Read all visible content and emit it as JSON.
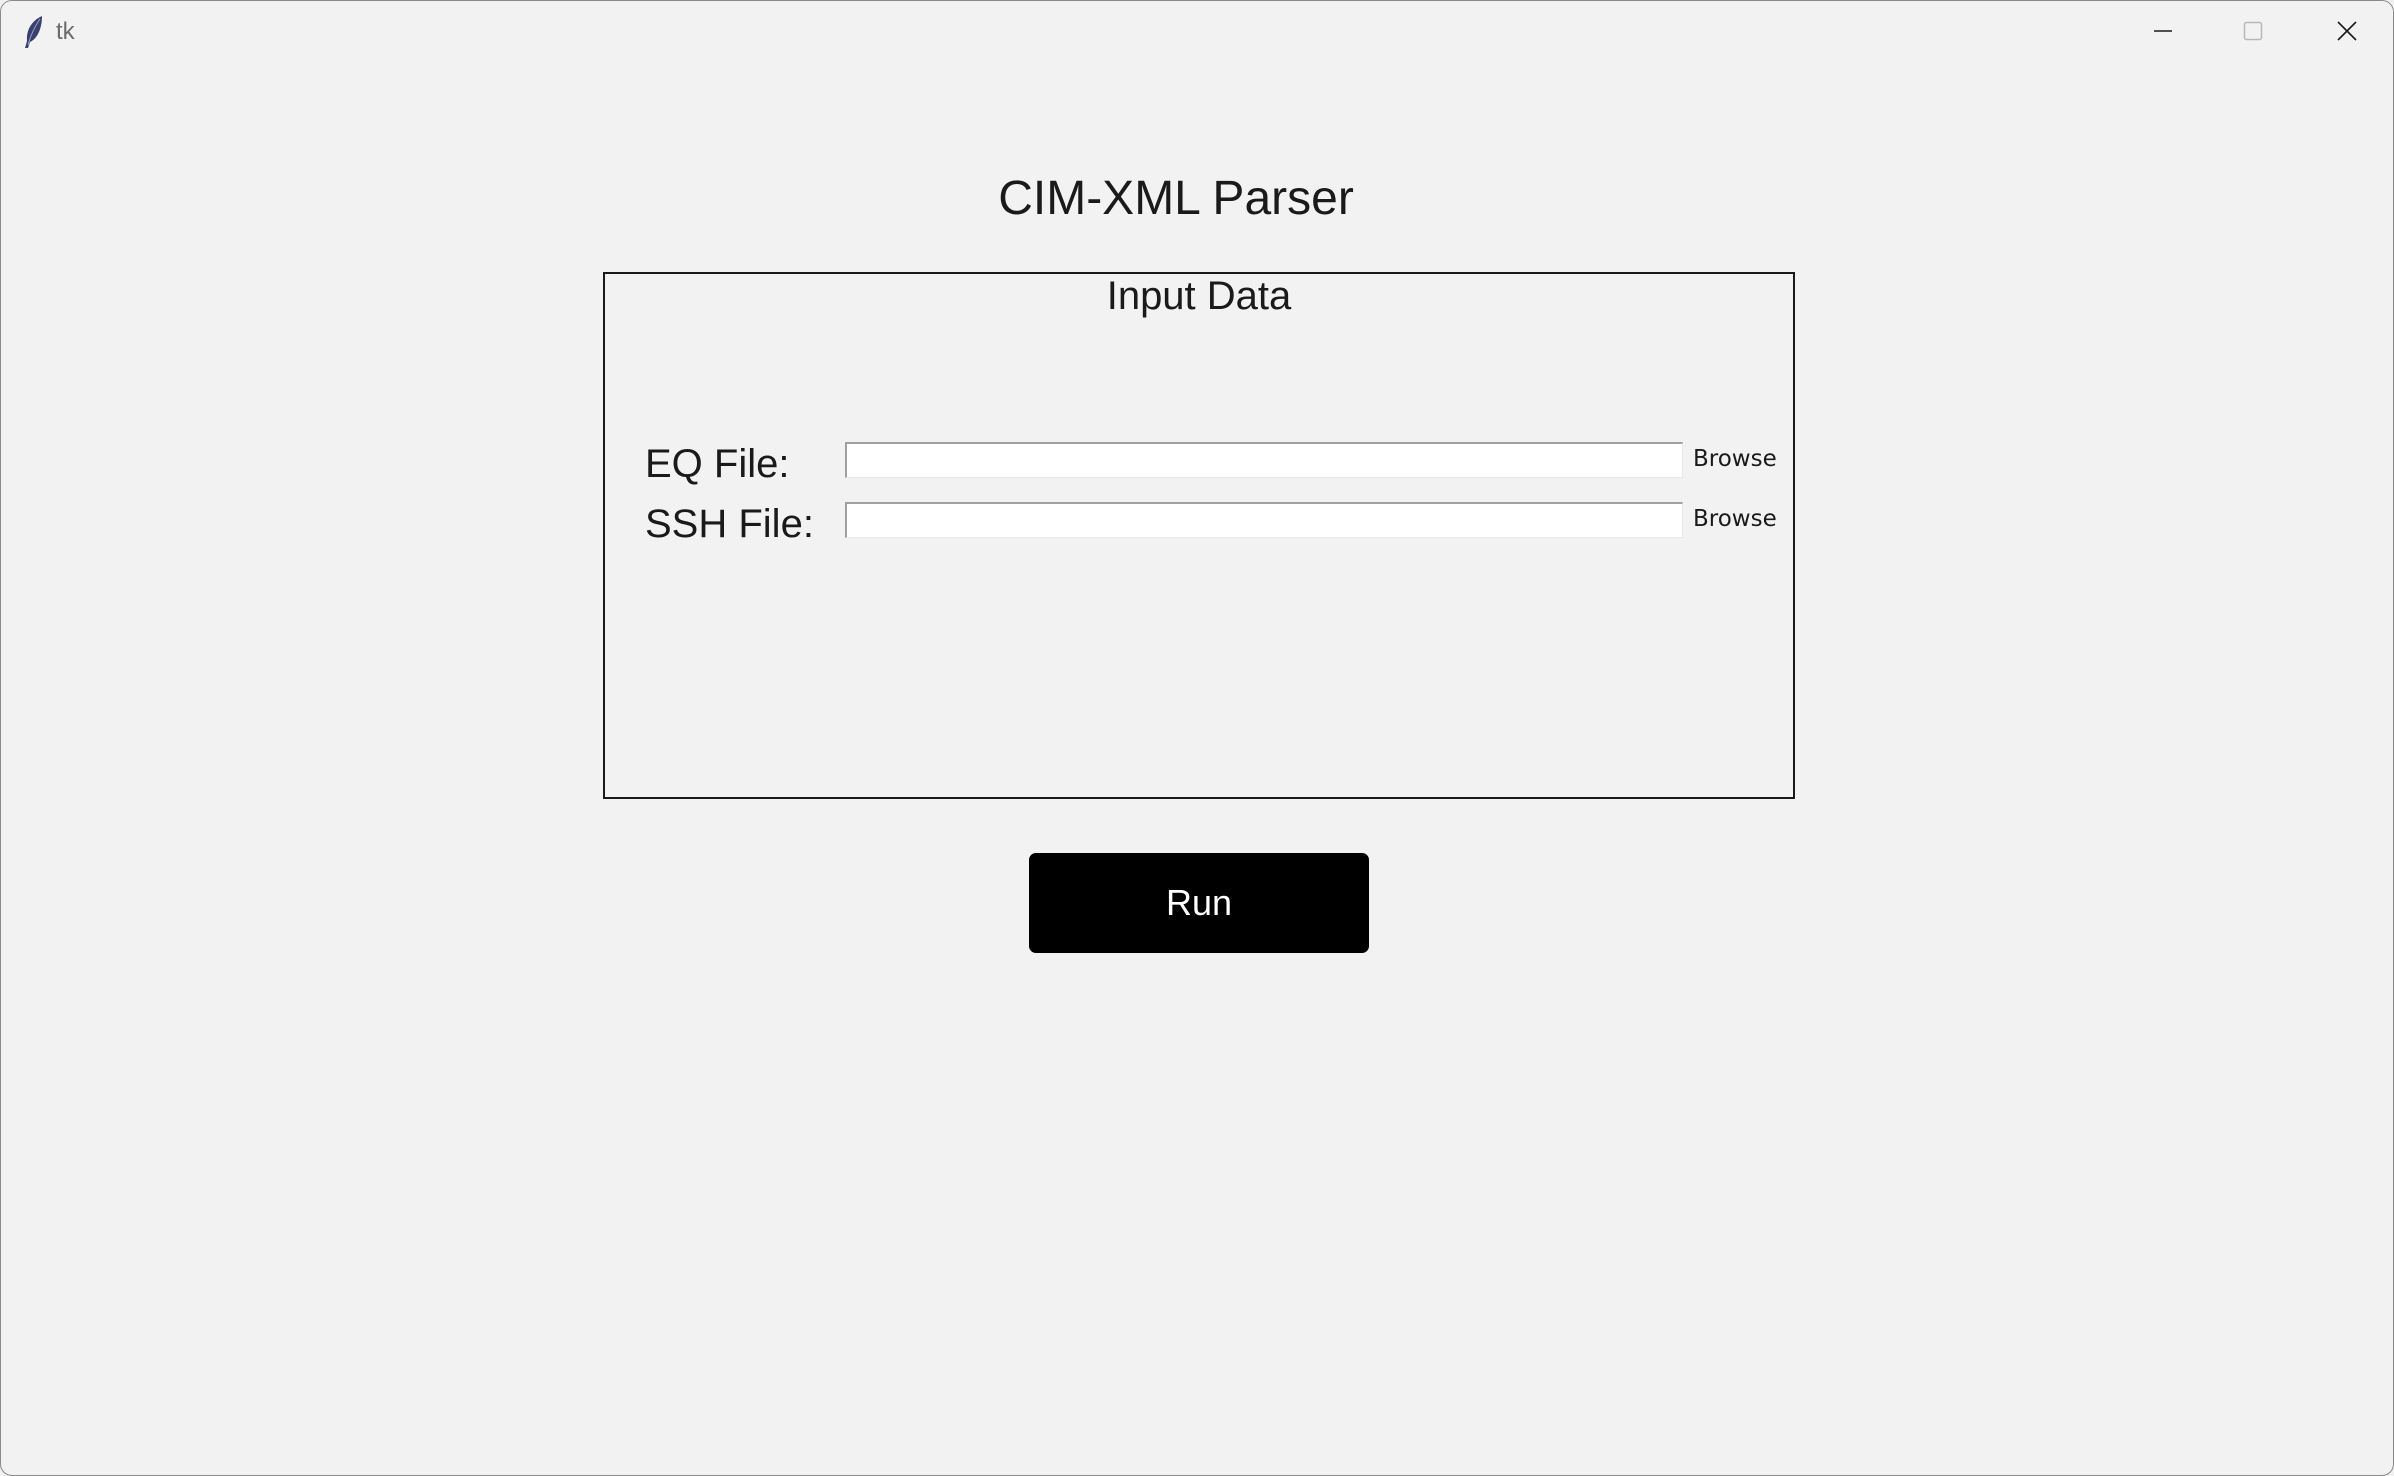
{
  "window": {
    "title": "tk",
    "controls": {
      "minimize_icon": "minimize-icon",
      "maximize_icon": "maximize-icon",
      "close_icon": "close-icon"
    }
  },
  "app": {
    "title": "CIM-XML Parser"
  },
  "input_frame": {
    "title": "Input Data",
    "rows": [
      {
        "label": "EQ File:",
        "value": "",
        "browse_label": "Browse"
      },
      {
        "label": "SSH File:",
        "value": "",
        "browse_label": "Browse"
      }
    ]
  },
  "actions": {
    "run_label": "Run"
  },
  "colors": {
    "background": "#f2f2f2",
    "run_button_bg": "#000000",
    "run_button_fg": "#ffffff",
    "frame_border": "#1a1a1a"
  }
}
